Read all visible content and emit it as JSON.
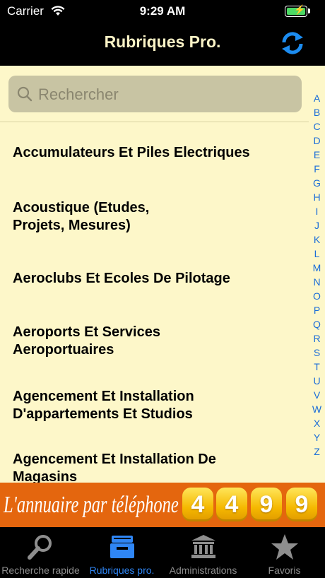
{
  "status_bar": {
    "carrier": "Carrier",
    "time": "9:29 AM"
  },
  "nav": {
    "title": "Rubriques Pro."
  },
  "search": {
    "placeholder": "Rechercher"
  },
  "list": {
    "items": [
      {
        "label": "Accumulateurs Et Piles Electriques"
      },
      {
        "label": "Acoustique (Etudes, Projets, Mesures)"
      },
      {
        "label": "Aeroclubs Et Ecoles De Pilotage"
      },
      {
        "label": "Aeroports Et Services Aeroportuaires"
      },
      {
        "label": "Agencement Et Installation D'appartements Et Studios"
      },
      {
        "label": "Agencement Et Installation De Magasins"
      }
    ]
  },
  "index_letters": [
    "A",
    "B",
    "C",
    "D",
    "E",
    "F",
    "G",
    "H",
    "I",
    "J",
    "K",
    "L",
    "M",
    "N",
    "O",
    "P",
    "Q",
    "R",
    "S",
    "T",
    "U",
    "V",
    "W",
    "X",
    "Y",
    "Z"
  ],
  "banner": {
    "text": "L'annuaire par téléphone",
    "digits": [
      "4",
      "4",
      "9",
      "9"
    ]
  },
  "tabs": [
    {
      "label": "Recherche rapide",
      "icon": "magnifier-icon",
      "active": false
    },
    {
      "label": "Rubriques pro.",
      "icon": "inbox-tray-icon",
      "active": true
    },
    {
      "label": "Administrations",
      "icon": "building-icon",
      "active": false
    },
    {
      "label": "Favoris",
      "icon": "star-icon",
      "active": false
    }
  ],
  "colors": {
    "background": "#fdf7c9",
    "accent": "#2f86f5",
    "banner": "#e4660e",
    "bar": "#000000"
  }
}
